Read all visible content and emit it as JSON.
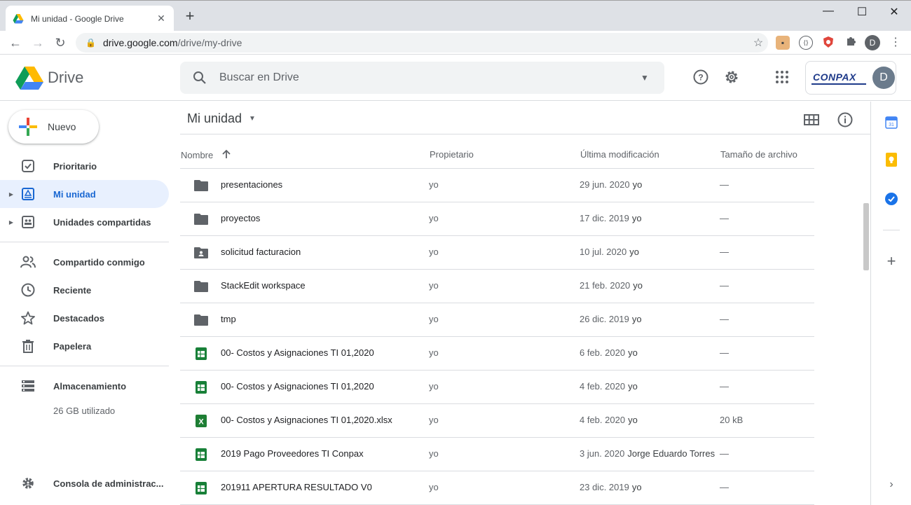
{
  "browser": {
    "tab_title": "Mi unidad - Google Drive",
    "url_host": "drive.google.com",
    "url_path": "/drive/my-drive",
    "profile_initial": "D",
    "new_tab_symbol": "+",
    "close_tab_symbol": "✕",
    "minimize_symbol": "—",
    "maximize_symbol": "☐",
    "close_window_symbol": "✕"
  },
  "header": {
    "product_name": "Drive",
    "search_placeholder": "Buscar en Drive",
    "org_logo_text": "CONPAX",
    "avatar_initial": "D"
  },
  "sidebar": {
    "new_label": "Nuevo",
    "items": [
      {
        "label": "Prioritario",
        "icon": "priority-check-icon"
      },
      {
        "label": "Mi unidad",
        "icon": "my-drive-icon",
        "active": true
      },
      {
        "label": "Unidades compartidas",
        "icon": "shared-drives-icon"
      },
      {
        "label": "Compartido conmigo",
        "icon": "people-icon"
      },
      {
        "label": "Reciente",
        "icon": "clock-icon"
      },
      {
        "label": "Destacados",
        "icon": "star-icon"
      },
      {
        "label": "Papelera",
        "icon": "trash-icon"
      },
      {
        "label": "Almacenamiento",
        "icon": "storage-icon"
      },
      {
        "label": "Consola de administrac...",
        "icon": "admin-gear-icon"
      }
    ],
    "storage_used": "26 GB utilizado"
  },
  "main": {
    "location": "Mi unidad",
    "columns": {
      "name": "Nombre",
      "owner": "Propietario",
      "modified": "Última modificación",
      "size": "Tamaño de archivo"
    },
    "files": [
      {
        "name": "presentaciones",
        "type": "folder",
        "owner": "yo",
        "modified": "29 jun. 2020",
        "by": "yo",
        "size": "—"
      },
      {
        "name": "proyectos",
        "type": "folder",
        "owner": "yo",
        "modified": "17 dic. 2019",
        "by": "yo",
        "size": "—"
      },
      {
        "name": "solicitud facturacion",
        "type": "shared-folder",
        "owner": "yo",
        "modified": "10 jul. 2020",
        "by": "yo",
        "size": "—"
      },
      {
        "name": "StackEdit workspace",
        "type": "folder",
        "owner": "yo",
        "modified": "21 feb. 2020",
        "by": "yo",
        "size": "—"
      },
      {
        "name": "tmp",
        "type": "folder",
        "owner": "yo",
        "modified": "26 dic. 2019",
        "by": "yo",
        "size": "—"
      },
      {
        "name": "00- Costos y Asignaciones TI 01,2020",
        "type": "sheet",
        "owner": "yo",
        "modified": "6 feb. 2020",
        "by": "yo",
        "size": "—"
      },
      {
        "name": "00- Costos y Asignaciones TI 01,2020",
        "type": "sheet",
        "owner": "yo",
        "modified": "4 feb. 2020",
        "by": "yo",
        "size": "—"
      },
      {
        "name": "00- Costos y Asignaciones TI 01,2020.xlsx",
        "type": "excel",
        "owner": "yo",
        "modified": "4 feb. 2020",
        "by": "yo",
        "size": "20 kB"
      },
      {
        "name": "2019 Pago Proveedores TI Conpax",
        "type": "sheet",
        "owner": "yo",
        "modified": "3 jun. 2020",
        "by": "Jorge Eduardo Torres",
        "size": "—"
      },
      {
        "name": "201911 APERTURA RESULTADO V0",
        "type": "sheet",
        "owner": "yo",
        "modified": "23 dic. 2019",
        "by": "yo",
        "size": "—"
      }
    ]
  },
  "colors": {
    "accent": "#1967d2",
    "active_bg": "#e8f0fe",
    "sheets_green": "#188038",
    "excel_green": "#1e7e34"
  }
}
